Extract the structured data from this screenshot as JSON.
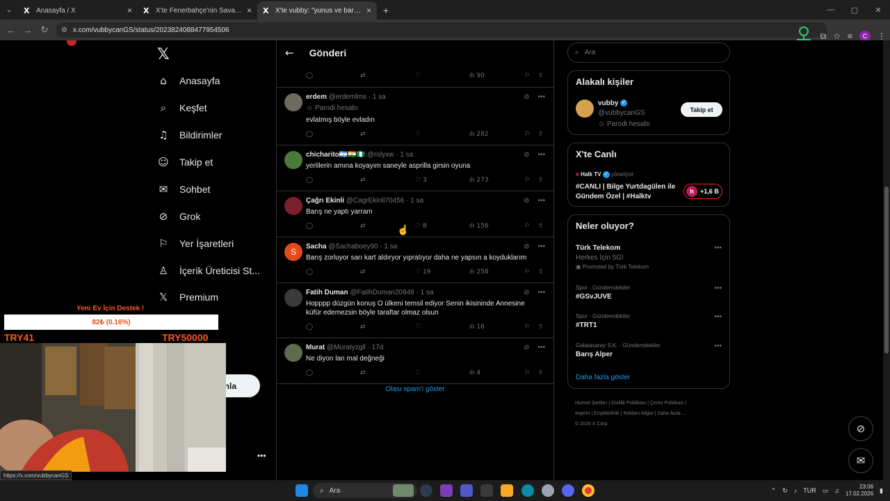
{
  "browser": {
    "tabs": [
      {
        "title": "Anasayfa / X",
        "active": false
      },
      {
        "title": "X'te Fenerbahçe'nin Savaşçı Ru",
        "active": false
      },
      {
        "title": "X'te vubby: \"yunus ve barış çab",
        "active": true
      }
    ],
    "url": "x.com/vubbycanGS/status/2023824088477954506",
    "profile_letter": "C"
  },
  "nav": {
    "items": [
      {
        "label": "Anasayfa",
        "icon": "home-icon"
      },
      {
        "label": "Keşfet",
        "icon": "search-icon"
      },
      {
        "label": "Bildirimler",
        "icon": "bell-icon"
      },
      {
        "label": "Takip et",
        "icon": "follow-icon"
      },
      {
        "label": "Sohbet",
        "icon": "mail-icon"
      },
      {
        "label": "Grok",
        "icon": "grok-icon"
      },
      {
        "label": "Yer İşaretleri",
        "icon": "bookmark-icon"
      },
      {
        "label": "İçerik Üreticisi St...",
        "icon": "creator-icon"
      },
      {
        "label": "Premium",
        "icon": "x-icon"
      }
    ],
    "post_button": "nla"
  },
  "main": {
    "header_title": "Gönderi",
    "top_row": {
      "views": "90"
    },
    "tweets": [
      {
        "name": "erdem",
        "handle": "@erdemlms",
        "time": "1 sa",
        "sub": "Parodi hesabı",
        "text": "evlatmış böyle evladın",
        "replies": "",
        "retweets": "",
        "likes": "",
        "views": "282"
      },
      {
        "name": "chicharito🇦🇷🇮🇳🇳🇬",
        "handle": "@rolyxw",
        "time": "1 sa",
        "sub": "",
        "text": "yerlilerin amına koyayım saneyle asprilla girsin oyuna",
        "replies": "",
        "retweets": "",
        "likes": "3",
        "views": "273"
      },
      {
        "name": "Çağrı Ekinli",
        "handle": "@CagrEkinli70456",
        "time": "1 sa",
        "sub": "",
        "text": "Barış ne yaptı yarram",
        "replies": "",
        "retweets": "",
        "likes": "8",
        "views": "156"
      },
      {
        "name": "Sacha",
        "handle": "@Sachaboey90",
        "time": "1 sa",
        "sub": "",
        "text": "Barış zorluyor sarı kart aldıryor yıpratıyor daha ne yapsın a koyduklarım",
        "replies": "",
        "retweets": "",
        "likes": "19",
        "views": "258"
      },
      {
        "name": "Fatih Duman",
        "handle": "@FatihDuman20948",
        "time": "1 sa",
        "sub": "",
        "text": "Hopppp düzgün konuş O ülkeni temsil ediyor Senin ikisininde Annesine küfür edemezsin böyle taraftar olmaz olsun",
        "replies": "",
        "retweets": "",
        "likes": "",
        "views": "16"
      },
      {
        "name": "Murat",
        "handle": "@Muratyzgll",
        "time": "17d",
        "sub": "",
        "text": "Ne diyon lan mal değneği",
        "replies": "",
        "retweets": "",
        "likes": "4",
        "views": ""
      }
    ],
    "spam_link": "Olası spam'i göster"
  },
  "right": {
    "search_placeholder": "Ara",
    "related": {
      "title": "Alakalı kişiler",
      "name": "vubby",
      "handle": "@vubbycanGS",
      "sub": "Parodi hesabı",
      "follow_label": "Takip et"
    },
    "live": {
      "title": "X'te Canlı",
      "channel": "Halk TV",
      "role": "yönetiyor",
      "text": "#CANLI | Bilge Yurtdagülen ile Gündem Özel | #Halktv",
      "count": "+1,6 B"
    },
    "trends": {
      "title": "Neler oluyor?",
      "promo_name": "Türk Telekom",
      "promo_sub": "Herkes İçin 5G!",
      "promo_by": "Promoted by Türk Telekom",
      "items": [
        {
          "meta": "Spor · Gündemdekiler",
          "name": "#GSvJUVE"
        },
        {
          "meta": "Spor · Gündemdekiler",
          "name": "#TRT1"
        },
        {
          "meta": "Galatasaray S.K. · Gündemdekiler",
          "name": "Barış Alper"
        }
      ],
      "more": "Daha fazla göster"
    },
    "footer": [
      "Hizmet Şartları",
      "Gizlilik Politikası",
      "Çerez Politikası",
      "Imprint",
      "Erişilebilirlik",
      "Reklam bilgisi",
      "Daha fazla ...",
      "© 2026 X Corp."
    ]
  },
  "overlay": {
    "title": "Yeni Ev İçin Destek !",
    "progress_text": "82₺ (0.16%)",
    "progress_fraction": 0.0016,
    "min_label": "TRY41",
    "max_label": "TRY50000"
  },
  "status_url": "https://x.com/vubbycanGS",
  "taskbar": {
    "search_label": "Ara",
    "lang": "TUR",
    "time": "23:06",
    "date": "17.02.2026"
  },
  "colors": {
    "accent": "#1d9bf0",
    "live": "#f4212e",
    "overlay": "#ff5722"
  }
}
